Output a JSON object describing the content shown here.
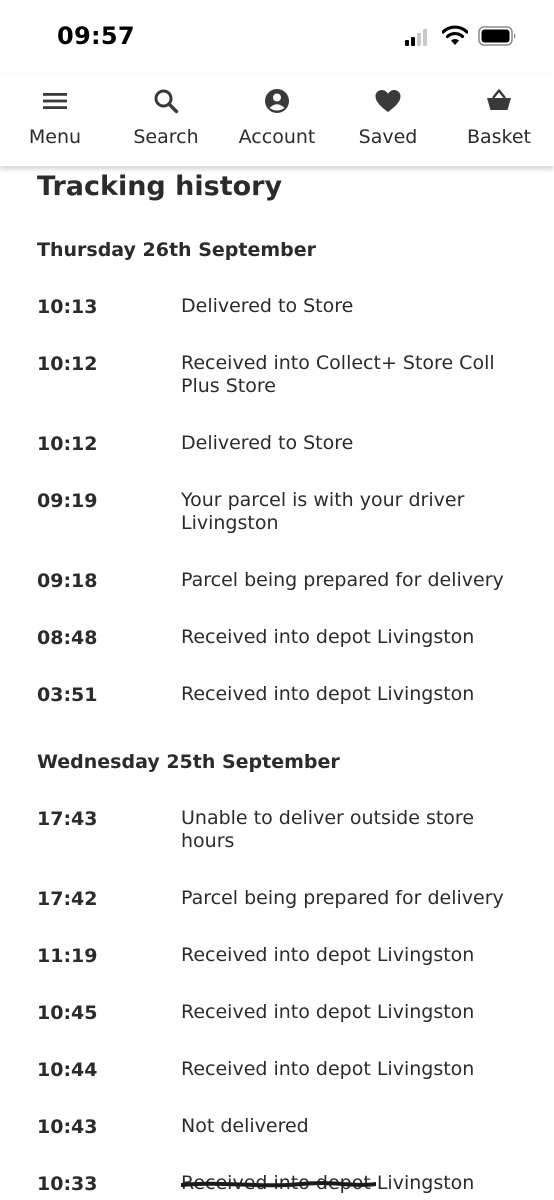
{
  "status_bar": {
    "time": "09:57"
  },
  "nav": {
    "items": [
      {
        "label": "Menu",
        "icon": "menu-icon"
      },
      {
        "label": "Search",
        "icon": "search-icon"
      },
      {
        "label": "Account",
        "icon": "account-icon"
      },
      {
        "label": "Saved",
        "icon": "heart-icon"
      },
      {
        "label": "Basket",
        "icon": "basket-icon"
      }
    ]
  },
  "page": {
    "title": "Tracking history"
  },
  "days": [
    {
      "heading": "Thursday 26th September",
      "events": [
        {
          "time": "10:13",
          "description": "Delivered to Store"
        },
        {
          "time": "10:12",
          "description": "Received into Collect+ Store Coll Plus Store"
        },
        {
          "time": "10:12",
          "description": "Delivered to Store"
        },
        {
          "time": "09:19",
          "description": "Your parcel is with your driver Livingston"
        },
        {
          "time": "09:18",
          "description": "Parcel being prepared for delivery"
        },
        {
          "time": "08:48",
          "description": "Received into depot Livingston"
        },
        {
          "time": "03:51",
          "description": "Received into depot Livingston"
        }
      ]
    },
    {
      "heading": "Wednesday 25th September",
      "events": [
        {
          "time": "17:43",
          "description": "Unable to deliver outside store hours"
        },
        {
          "time": "17:42",
          "description": "Parcel being prepared for delivery"
        },
        {
          "time": "11:19",
          "description": "Received into depot Livingston"
        },
        {
          "time": "10:45",
          "description": "Received into depot Livingston"
        },
        {
          "time": "10:44",
          "description": "Received into depot Livingston"
        },
        {
          "time": "10:43",
          "description": "Not delivered"
        },
        {
          "time": "10:33",
          "description": "Received into depot Livingston"
        }
      ]
    }
  ]
}
